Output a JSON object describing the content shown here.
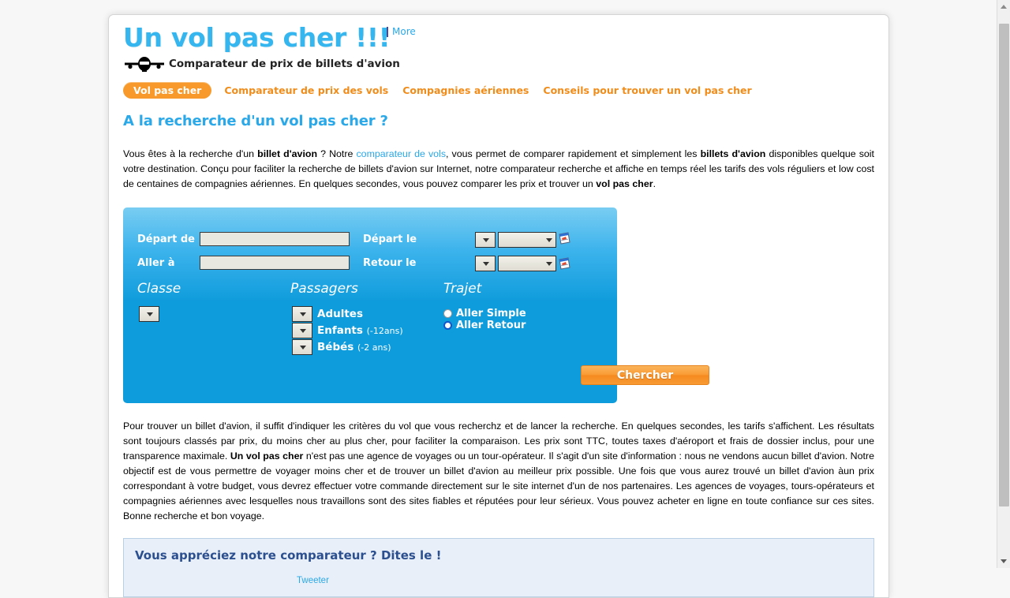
{
  "site": {
    "logo_title": "Un vol pas cher !!!",
    "logo_tagline": "Comparateur de prix de billets d'avion",
    "plane_icon": "airplane-front-icon",
    "more_label": "More"
  },
  "nav": {
    "items": [
      {
        "label": "Vol pas cher",
        "active": true
      },
      {
        "label": "Comparateur de prix des vols",
        "active": false
      },
      {
        "label": "Compagnies aériennes",
        "active": false
      },
      {
        "label": "Conseils pour trouver un vol pas cher",
        "active": false
      }
    ]
  },
  "page": {
    "heading": "A la recherche d'un vol pas cher ?",
    "intro": {
      "p1": "Vous êtes à la recherche d'un ",
      "b1": "billet d'avion",
      "p2": " ? Notre ",
      "link1": "comparateur de vols",
      "p3": ", vous permet de comparer rapidement et simplement les ",
      "b2": "billets d'avion",
      "p4": " disponibles quelque soit votre destination. Conçu pour faciliter la recherche de billets d'avion sur Internet, notre comparateur recherche et affiche en temps réel les tarifs des vols réguliers et low cost de centaines de compagnies aériennes. En quelques secondes, vous pouvez comparer les prix et trouver un ",
      "b3": "vol pas cher",
      "p5": "."
    },
    "detail": {
      "p1": "Pour trouver un billet d'avion, il suffit d'indiquer les critères du vol que vous recherchz et de lancer la recherche. En quelques secondes, les tarifs s'affichent. Les résultats sont toujours classés par prix, du moins cher au plus cher, pour faciliter la comparaison. Les prix sont TTC, toutes taxes d'aéroport et frais de dossier inclus, pour une transparence maximale. ",
      "b1": "Un vol pas cher",
      "p2": " n'est pas une agence de voyages ou un tour-opérateur. Il s'agit d'un site d'information : nous ne vendons aucun billet d'avion. Notre objectif est de vous permettre de voyager moins cher et de trouver un billet d'avion au meilleur prix possible. Une fois que vous aurez trouvé un billet d'avion àun prix correspondant à votre budget, vous devrez effectuer votre commande directement sur le site internet d'un de nos partenaires. Les agences de voyages, tours-opérateurs et compagnies aériennes avec lesquelles nous travaillons sont des sites fiables et réputées pour leur sérieux. Vous pouvez acheter en ligne en toute confiance sur ces sites. Bonne recherche et bon voyage."
    }
  },
  "search_form": {
    "depart_de_label": "Départ de",
    "depart_de_value": "",
    "depart_de_placeholder": "",
    "aller_a_label": "Aller à",
    "aller_a_value": "",
    "aller_a_placeholder": "",
    "depart_le_label": "Départ le",
    "retour_le_label": "Retour le",
    "depart_day_value": "",
    "depart_month_value": "",
    "retour_day_value": "",
    "retour_month_value": "",
    "calendar_icon": "calendar-picker-icon",
    "classe_title": "Classe",
    "classe_value": "",
    "passagers_title": "Passagers",
    "passagers": [
      {
        "label": "Adultes",
        "age": "",
        "value": ""
      },
      {
        "label": "Enfants",
        "age": "(-12ans)",
        "value": ""
      },
      {
        "label": "Bébés",
        "age": "(-2 ans)",
        "value": ""
      }
    ],
    "trajet_title": "Trajet",
    "trajet_options": [
      {
        "label": "Aller Simple",
        "selected": false,
        "focused": false
      },
      {
        "label": "Aller Retour",
        "selected": false,
        "focused": true
      }
    ],
    "submit_label": "Chercher"
  },
  "share_box": {
    "heading": "Vous appréciez notre comparateur ? Dites le !",
    "tweet_label": "Tweeter"
  },
  "colors": {
    "brand_blue": "#2aa8e8",
    "brand_orange": "#f08c1a",
    "nav_active_bg": "#f79a2b",
    "panel_top": "#79cdf2",
    "panel_bottom": "#0f9cdc",
    "button_orange": "#f99a33",
    "share_box_bg": "#e8eff8",
    "share_heading": "#2b4f8f"
  }
}
